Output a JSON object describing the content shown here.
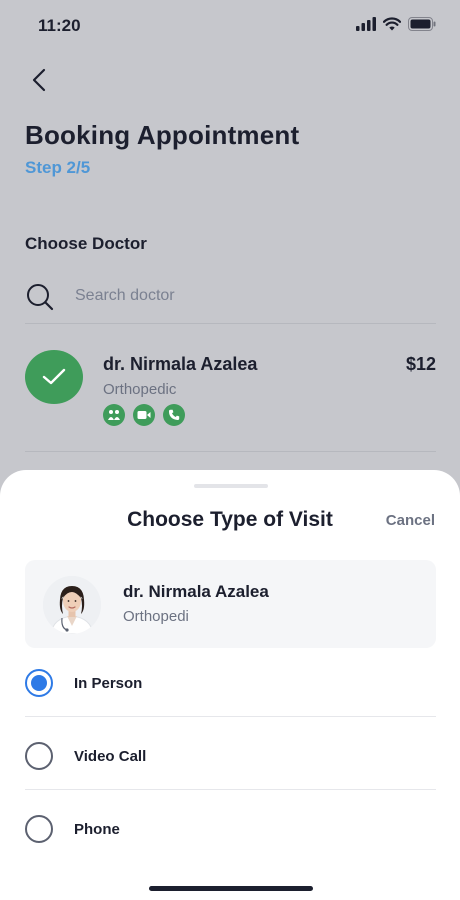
{
  "status_bar": {
    "time": "11:20"
  },
  "header": {
    "title": "Booking Appointment",
    "step": "Step 2/5"
  },
  "doctor_section": {
    "title": "Choose Doctor",
    "search_placeholder": "Search doctor"
  },
  "selected_doctor": {
    "name": "dr. Nirmala Azalea",
    "specialty": "Orthopedic",
    "price": "$12",
    "visit_icons": [
      "in-person-icon",
      "video-icon",
      "phone-icon"
    ]
  },
  "sheet": {
    "title": "Choose Type of Visit",
    "cancel_label": "Cancel",
    "doctor": {
      "name": "dr. Nirmala Azalea",
      "specialty": "Orthopedi"
    },
    "options": [
      {
        "label": "In Person",
        "selected": true
      },
      {
        "label": "Video Call",
        "selected": false
      },
      {
        "label": "Phone",
        "selected": false
      }
    ]
  },
  "colors": {
    "accent": "#2e7ae6",
    "step": "#4f97d6",
    "success": "#3f9c5a",
    "overlay_bg": "#c6c7cc"
  }
}
